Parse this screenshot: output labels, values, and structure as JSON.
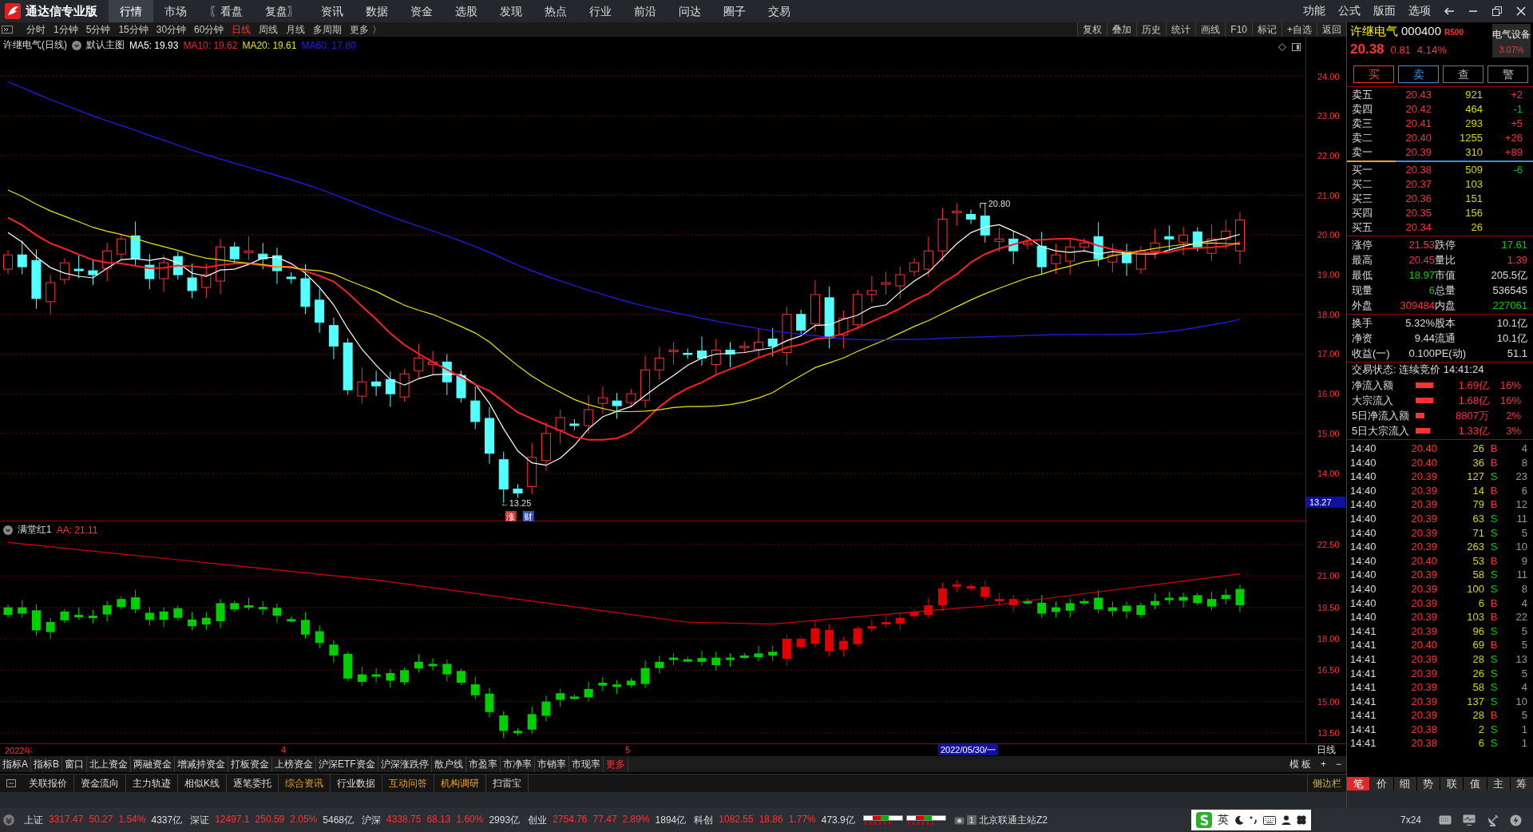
{
  "app": {
    "title": "通达信专业版"
  },
  "menu": [
    {
      "label": "行情",
      "selected": true
    },
    {
      "label": "市场",
      "selected": false
    },
    {
      "label": "〖看盘",
      "selected": false
    },
    {
      "label": "复盘〗",
      "selected": false
    },
    {
      "label": "资讯",
      "selected": false
    },
    {
      "label": "数据",
      "selected": false
    },
    {
      "label": "资金",
      "selected": false
    },
    {
      "label": "选股",
      "selected": false
    },
    {
      "label": "发现",
      "selected": false
    },
    {
      "label": "热点",
      "selected": false
    },
    {
      "label": "行业",
      "selected": false
    },
    {
      "label": "前沿",
      "selected": false
    },
    {
      "label": "问达",
      "selected": false
    },
    {
      "label": "圈子",
      "selected": false
    },
    {
      "label": "交易",
      "selected": false
    }
  ],
  "window_menu": [
    "功能",
    "公式",
    "版面",
    "选项"
  ],
  "periods": [
    {
      "label": "分时",
      "selected": false
    },
    {
      "label": "1分钟",
      "selected": false
    },
    {
      "label": "5分钟",
      "selected": false
    },
    {
      "label": "15分钟",
      "selected": false
    },
    {
      "label": "30分钟",
      "selected": false
    },
    {
      "label": "60分钟",
      "selected": false
    },
    {
      "label": "日线",
      "selected": true
    },
    {
      "label": "周线",
      "selected": false
    },
    {
      "label": "月线",
      "selected": false
    },
    {
      "label": "多周期",
      "selected": false
    },
    {
      "label": "更多 〉",
      "selected": false
    }
  ],
  "chart_tools": [
    "复权",
    "叠加",
    "历史",
    "统计",
    "画线",
    "F10",
    "标记",
    "+自选",
    "返回"
  ],
  "main_chart": {
    "title": "许继电气(日线)",
    "template": "默认主图",
    "ma": [
      {
        "label": "MA5: 19.93",
        "color": "#ffffff"
      },
      {
        "label": "MA10: 19.62",
        "color": "#ff2020"
      },
      {
        "label": "MA20: 19.61",
        "color": "#e6e600"
      },
      {
        "label": "MA60: 17.80",
        "color": "#2020ff"
      }
    ],
    "high_label": "20.80",
    "low_label": "←13.25",
    "tags": [
      {
        "label": "涨",
        "color": "#c83232"
      },
      {
        "label": "财",
        "color": "#3250c8"
      }
    ],
    "yaxis": [
      "24.00",
      "23.00",
      "22.00",
      "21.00",
      "20.00",
      "19.00",
      "18.00",
      "17.00",
      "16.00",
      "15.00",
      "14.00"
    ],
    "cursor_price": "13.27"
  },
  "indicator": {
    "name": "满堂红1",
    "value": "AA: 21.11",
    "yaxis": [
      "22.50",
      "21.00",
      "19.50",
      "18.00",
      "16.50",
      "15.00",
      "13.50"
    ]
  },
  "time_axis": {
    "labels": [
      "2022年",
      "4",
      "5"
    ],
    "cursor_date": "2022/05/30/一",
    "period": "日线"
  },
  "indicator_tabs": [
    {
      "label": "指标A",
      "kind": "tab"
    },
    {
      "label": "指标B",
      "kind": "tab"
    },
    {
      "label": "窗口",
      "kind": "tab"
    },
    {
      "label": "北上资金",
      "kind": "tab"
    },
    {
      "label": "两融资金",
      "kind": "tab"
    },
    {
      "label": "增减持资金",
      "kind": "tab"
    },
    {
      "label": "打板资金",
      "kind": "tab"
    },
    {
      "label": "上榜资金",
      "kind": "tab"
    },
    {
      "label": "沪深ETF资金",
      "kind": "tab"
    },
    {
      "label": "沪深涨跌停",
      "kind": "tab"
    },
    {
      "label": "散户线",
      "kind": "tab"
    },
    {
      "label": "市盈率",
      "kind": "tab"
    },
    {
      "label": "市净率",
      "kind": "tab"
    },
    {
      "label": "市销率",
      "kind": "tab"
    },
    {
      "label": "市现率",
      "kind": "tab"
    },
    {
      "label": "更多",
      "kind": "more"
    }
  ],
  "panel_controls": [
    "模 板",
    "+",
    "−"
  ],
  "info_tabs": [
    {
      "label": "关联报价",
      "highlight": false
    },
    {
      "label": "资金流向",
      "highlight": false
    },
    {
      "label": "主力轨迹",
      "highlight": false
    },
    {
      "label": "相似K线",
      "highlight": false
    },
    {
      "label": "逐笔委托",
      "highlight": false
    },
    {
      "label": "综合资讯",
      "highlight": true
    },
    {
      "label": "行业数据",
      "highlight": false
    },
    {
      "label": "互动问答",
      "highlight": true
    },
    {
      "label": "机构调研",
      "highlight": true
    },
    {
      "label": "扫雷宝",
      "highlight": false
    }
  ],
  "sidebar_toggle": "侧边栏",
  "quote": {
    "name": "许继电气",
    "code": "000400",
    "flag": "R",
    "flag_value": "500",
    "price": "20.38",
    "change": "0.81",
    "change_pct": "4.14%",
    "sector": "电气设备",
    "sector_pct": "3.07%",
    "actions": [
      "买",
      "卖",
      "查",
      "警"
    ]
  },
  "asks": [
    {
      "label": "卖五",
      "price": "20.43",
      "volume": "921",
      "delta": "+2",
      "color": "#ff3232"
    },
    {
      "label": "卖四",
      "price": "20.42",
      "volume": "464",
      "delta": "-1",
      "color": "#00d000"
    },
    {
      "label": "卖三",
      "price": "20.41",
      "volume": "293",
      "delta": "+5",
      "color": "#ff3232"
    },
    {
      "label": "卖二",
      "price": "20.40",
      "volume": "1255",
      "delta": "+26",
      "color": "#ff3232"
    },
    {
      "label": "卖一",
      "price": "20.39",
      "volume": "310",
      "delta": "+89",
      "color": "#ff3232"
    }
  ],
  "bids": [
    {
      "label": "买一",
      "price": "20.38",
      "volume": "509",
      "delta": "-6",
      "color": "#00d000"
    },
    {
      "label": "买二",
      "price": "20.37",
      "volume": "103"
    },
    {
      "label": "买三",
      "price": "20.36",
      "volume": "151"
    },
    {
      "label": "买四",
      "price": "20.35",
      "volume": "156"
    },
    {
      "label": "买五",
      "price": "20.34",
      "volume": "26"
    }
  ],
  "stats": [
    {
      "label": "涨停",
      "value": "21.53",
      "color": "#ff3232"
    },
    {
      "label": "跌停",
      "value": "17.61",
      "color": "#00d000"
    },
    {
      "label": "最高",
      "value": "20.45",
      "color": "#ff3232"
    },
    {
      "label": "量比",
      "value": "1.39",
      "color": "#ff3232"
    },
    {
      "label": "最低",
      "value": "18.97",
      "color": "#00d000"
    },
    {
      "label": "市值",
      "value": "205.5亿",
      "color": "#dddddd"
    },
    {
      "label": "现量",
      "value": "6",
      "color": "#00d000"
    },
    {
      "label": "总量",
      "value": "536545",
      "color": "#dddddd"
    },
    {
      "label": "外盘",
      "value": "309484",
      "color": "#ff3232"
    },
    {
      "label": "内盘",
      "value": "227061",
      "color": "#00d000"
    }
  ],
  "fundamentals": [
    {
      "label": "换手",
      "value": "5.32%"
    },
    {
      "label": "股本",
      "value": "10.1亿"
    },
    {
      "label": "净资",
      "value": "9.44"
    },
    {
      "label": "流通",
      "value": "10.1亿"
    },
    {
      "label": "收益(一)",
      "value": "0.100"
    },
    {
      "label": "PE(动)",
      "value": "51.1"
    }
  ],
  "trade_status": "交易状态: 连续竞价 14:41:24",
  "flows": [
    {
      "label": "净流入额",
      "amount": "1.69亿",
      "pct": "16%"
    },
    {
      "label": "大宗流入",
      "amount": "1.68亿",
      "pct": "16%"
    },
    {
      "label": "5日净流入额",
      "amount": "8807万",
      "pct": "2%"
    },
    {
      "label": "5日大宗流入",
      "amount": "1.33亿",
      "pct": "3%"
    }
  ],
  "ticks": [
    {
      "time": "14:40",
      "price": "20.40",
      "volume": "26",
      "side": "B",
      "color": "#ff3232",
      "count": "4"
    },
    {
      "time": "14:40",
      "price": "20.40",
      "volume": "36",
      "side": "B",
      "color": "#ff3232",
      "count": "8"
    },
    {
      "time": "14:40",
      "price": "20.39",
      "volume": "127",
      "side": "S",
      "color": "#00d000",
      "count": "23"
    },
    {
      "time": "14:40",
      "price": "20.39",
      "volume": "14",
      "side": "B",
      "color": "#ff3232",
      "count": "6"
    },
    {
      "time": "14:40",
      "price": "20.39",
      "volume": "79",
      "side": "B",
      "color": "#ff3232",
      "count": "12"
    },
    {
      "time": "14:40",
      "price": "20.39",
      "volume": "63",
      "side": "S",
      "color": "#00d000",
      "count": "11"
    },
    {
      "time": "14:40",
      "price": "20.39",
      "volume": "71",
      "side": "S",
      "color": "#00d000",
      "count": "5"
    },
    {
      "time": "14:40",
      "price": "20.39",
      "volume": "263",
      "side": "S",
      "color": "#00d000",
      "count": "10"
    },
    {
      "time": "14:40",
      "price": "20.40",
      "volume": "53",
      "side": "B",
      "color": "#ff3232",
      "count": "9"
    },
    {
      "time": "14:40",
      "price": "20.39",
      "volume": "58",
      "side": "S",
      "color": "#00d000",
      "count": "11"
    },
    {
      "time": "14:40",
      "price": "20.39",
      "volume": "100",
      "side": "S",
      "color": "#00d000",
      "count": "8"
    },
    {
      "time": "14:40",
      "price": "20.39",
      "volume": "6",
      "side": "B",
      "color": "#ff3232",
      "count": "4"
    },
    {
      "time": "14:40",
      "price": "20.39",
      "volume": "103",
      "side": "B",
      "color": "#ff3232",
      "count": "22"
    },
    {
      "time": "14:41",
      "price": "20.39",
      "volume": "96",
      "side": "S",
      "color": "#00d000",
      "count": "5"
    },
    {
      "time": "14:41",
      "price": "20.40",
      "volume": "69",
      "side": "B",
      "color": "#ff3232",
      "count": "5"
    },
    {
      "time": "14:41",
      "price": "20.39",
      "volume": "28",
      "side": "S",
      "color": "#00d000",
      "count": "13"
    },
    {
      "time": "14:41",
      "price": "20.39",
      "volume": "26",
      "side": "S",
      "color": "#00d000",
      "count": "5"
    },
    {
      "time": "14:41",
      "price": "20.39",
      "volume": "58",
      "side": "S",
      "color": "#00d000",
      "count": "4"
    },
    {
      "time": "14:41",
      "price": "20.39",
      "volume": "137",
      "side": "S",
      "color": "#00d000",
      "count": "10"
    },
    {
      "time": "14:41",
      "price": "20.39",
      "volume": "28",
      "side": "B",
      "color": "#ff3232",
      "count": "5"
    },
    {
      "time": "14:41",
      "price": "20.38",
      "volume": "2",
      "side": "S",
      "color": "#00d000",
      "count": "1"
    },
    {
      "time": "14:41",
      "price": "20.38",
      "volume": "6",
      "side": "S",
      "color": "#00d000",
      "count": "1"
    }
  ],
  "side_tabs": [
    {
      "label": "笔",
      "selected": true
    },
    {
      "label": "价",
      "selected": false
    },
    {
      "label": "细",
      "selected": false
    },
    {
      "label": "势",
      "selected": false
    },
    {
      "label": "联",
      "selected": false
    },
    {
      "label": "值",
      "selected": false
    },
    {
      "label": "主",
      "selected": false
    },
    {
      "label": "筹",
      "selected": false
    }
  ],
  "status_bar": {
    "indices": [
      {
        "name": "上证",
        "value": "3317.47",
        "change": "50.27",
        "pct": "1.54%",
        "amount": "4337亿"
      },
      {
        "name": "深证",
        "value": "12497.1",
        "change": "250.59",
        "pct": "2.05%",
        "amount": "5468亿"
      },
      {
        "name": "沪深",
        "value": "4338.75",
        "change": "68.13",
        "pct": "1.60%",
        "amount": "2993亿"
      },
      {
        "name": "创业",
        "value": "2754.76",
        "change": "77.47",
        "pct": "2.89%",
        "amount": "1894亿"
      },
      {
        "name": "科创",
        "value": "1082.55",
        "change": "18.86",
        "pct": "1.77%",
        "amount": "473.9亿"
      }
    ],
    "server_number": "1",
    "server": "北京联通主站Z2",
    "ime_mode": "英",
    "service": "7x24"
  }
}
